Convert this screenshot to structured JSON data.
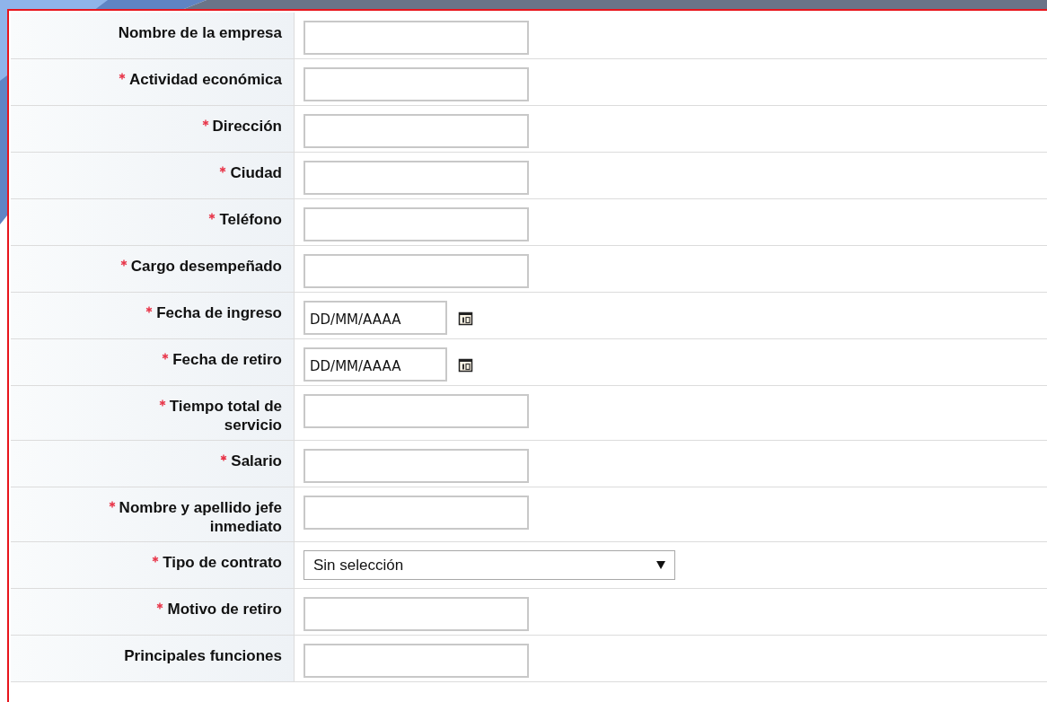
{
  "form_rows": [
    {
      "label": [
        "Nombre de la empresa"
      ],
      "required": false,
      "kind": "text"
    },
    {
      "label": [
        "Actividad económica"
      ],
      "required": true,
      "kind": "text"
    },
    {
      "label": [
        "Dirección"
      ],
      "required": true,
      "kind": "text"
    },
    {
      "label": [
        "Ciudad"
      ],
      "required": true,
      "kind": "text"
    },
    {
      "label": [
        "Teléfono"
      ],
      "required": true,
      "kind": "text"
    },
    {
      "label": [
        "Cargo desempeñado"
      ],
      "required": true,
      "kind": "text"
    },
    {
      "label": [
        "Fecha de ingreso"
      ],
      "required": true,
      "kind": "date",
      "placeholder": "DD/MM/AAAA"
    },
    {
      "label": [
        "Fecha de retiro"
      ],
      "required": true,
      "kind": "date",
      "placeholder": "DD/MM/AAAA"
    },
    {
      "label": [
        "Tiempo total de",
        "servicio"
      ],
      "required": true,
      "kind": "text"
    },
    {
      "label": [
        "Salario"
      ],
      "required": true,
      "kind": "text"
    },
    {
      "label": [
        "Nombre y apellido jefe",
        "inmediato"
      ],
      "required": true,
      "kind": "text"
    },
    {
      "label": [
        "Tipo de contrato"
      ],
      "required": true,
      "kind": "select",
      "value": "Sin selección"
    },
    {
      "label": [
        "Motivo de retiro"
      ],
      "required": true,
      "kind": "text"
    },
    {
      "label": [
        "Principales funciones"
      ],
      "required": false,
      "kind": "text"
    }
  ]
}
